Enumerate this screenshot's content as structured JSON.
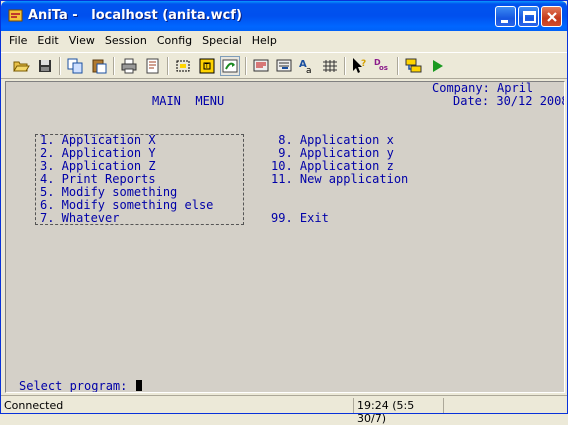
{
  "window": {
    "title": "AniTa -   localhost (anita.wcf)"
  },
  "menubar": {
    "items": [
      "File",
      "Edit",
      "View",
      "Session",
      "Config",
      "Special",
      "Help"
    ]
  },
  "toolbar": {
    "icons": [
      "open-folder-icon",
      "save-icon",
      "copy-icon",
      "paste-icon",
      "print-icon",
      "print-preview-icon",
      "select-icon",
      "keypad-icon",
      "refresh-icon",
      "screen-icon",
      "transfer-icon",
      "font-icon",
      "grid-icon",
      "help-pointer-icon",
      "dos-icon",
      "connect-icon",
      "run-icon"
    ]
  },
  "terminal": {
    "company": "Company: April",
    "date": "Date: 30/12 2008",
    "heading": "MAIN  MENU",
    "left_options": [
      "1. Application X",
      "2. Application Y",
      "3. Application Z",
      "4. Print Reports",
      "5. Modify something",
      "6. Modify something else",
      "7. Whatever"
    ],
    "right_options": [
      " 8. Application x",
      " 9. Application y",
      "10. Application z",
      "11. New application"
    ],
    "exit_option": "99. Exit",
    "prompt": "Select program:"
  },
  "statusbar": {
    "status": "Connected",
    "position": "19:24 (5:5 30/7)"
  },
  "colors": {
    "terminal_text": "#0000a8",
    "terminal_bg": "#d4d0c8",
    "titlebar": "#0053ee"
  }
}
